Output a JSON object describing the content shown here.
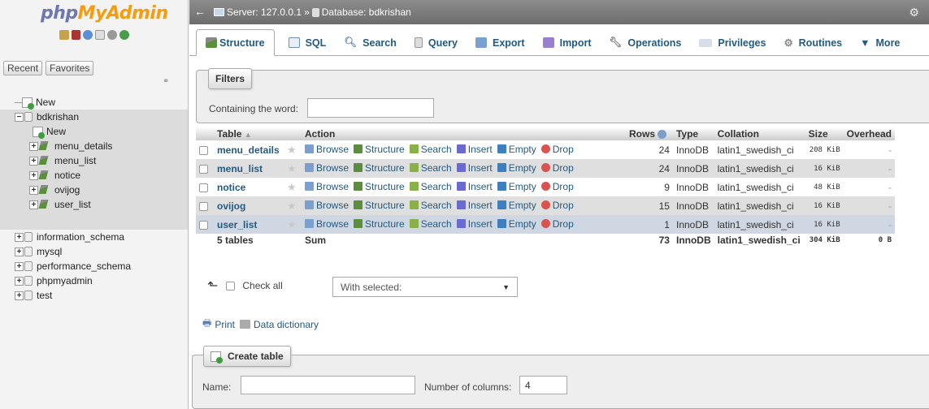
{
  "logo": {
    "part1": "php",
    "part2": "MyAdmin"
  },
  "nav": {
    "tabs": [
      "Recent",
      "Favorites"
    ],
    "new_label": "New",
    "db_selected": "bdkrishan",
    "db_new_label": "New",
    "tables": [
      "menu_details",
      "menu_list",
      "notice",
      "ovijog",
      "user_list"
    ],
    "other_dbs": [
      "information_schema",
      "mysql",
      "performance_schema",
      "phpmyadmin",
      "test"
    ]
  },
  "breadcrumb": {
    "server": "Server: 127.0.0.1",
    "sep": "»",
    "database": "Database: bdkrishan"
  },
  "tabs": [
    "Structure",
    "SQL",
    "Search",
    "Query",
    "Export",
    "Import",
    "Operations",
    "Privileges",
    "Routines",
    "More"
  ],
  "filters": {
    "legend": "Filters",
    "label": "Containing the word:",
    "value": ""
  },
  "table": {
    "headers": {
      "table": "Table",
      "action": "Action",
      "rows": "Rows",
      "type": "Type",
      "collation": "Collation",
      "size": "Size",
      "overhead": "Overhead"
    },
    "actions": [
      "Browse",
      "Structure",
      "Search",
      "Insert",
      "Empty",
      "Drop"
    ],
    "rows": [
      {
        "name": "menu_details",
        "rows": "24",
        "type": "InnoDB",
        "collation": "latin1_swedish_ci",
        "size": "208 KiB",
        "overhead": "-"
      },
      {
        "name": "menu_list",
        "rows": "24",
        "type": "InnoDB",
        "collation": "latin1_swedish_ci",
        "size": "16 KiB",
        "overhead": "-"
      },
      {
        "name": "notice",
        "rows": "9",
        "type": "InnoDB",
        "collation": "latin1_swedish_ci",
        "size": "48 KiB",
        "overhead": "-"
      },
      {
        "name": "ovijog",
        "rows": "15",
        "type": "InnoDB",
        "collation": "latin1_swedish_ci",
        "size": "16 KiB",
        "overhead": "-"
      },
      {
        "name": "user_list",
        "rows": "1",
        "type": "InnoDB",
        "collation": "latin1_swedish_ci",
        "size": "16 KiB",
        "overhead": "-"
      }
    ],
    "footer": {
      "count": "5 tables",
      "sum": "Sum",
      "rows": "73",
      "type": "InnoDB",
      "collation": "latin1_swedish_ci",
      "size": "304 KiB",
      "overhead": "0 B"
    }
  },
  "bulk": {
    "check_all": "Check all",
    "with_selected": "With selected:"
  },
  "links": {
    "print": "Print",
    "dictionary": "Data dictionary"
  },
  "create": {
    "legend": "Create table",
    "name_label": "Name:",
    "name_value": "",
    "cols_label": "Number of columns:",
    "cols_value": "4"
  },
  "colors": {
    "link": "#235a81",
    "topbar": "#7a7a7a",
    "row_alt": "#dfdfdf",
    "row_hl": "#cfd8e2"
  }
}
